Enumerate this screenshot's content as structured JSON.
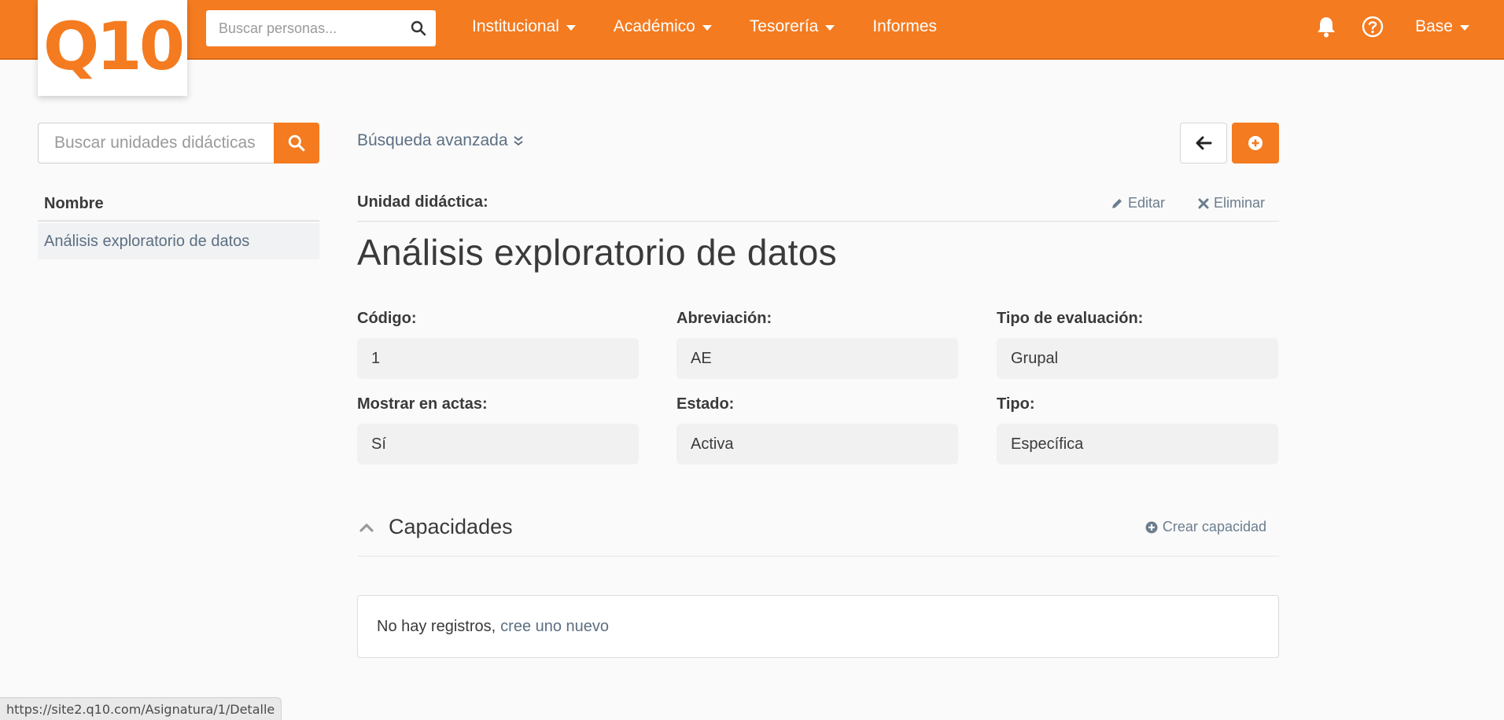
{
  "header": {
    "logo_text": "Q10",
    "search": {
      "placeholder": "Buscar personas..."
    },
    "nav": [
      {
        "label": "Institucional",
        "has_dropdown": true
      },
      {
        "label": "Académico",
        "has_dropdown": true
      },
      {
        "label": "Tesorería",
        "has_dropdown": true
      },
      {
        "label": "Informes",
        "has_dropdown": false
      }
    ],
    "icons": [
      "bell-icon",
      "help-circle-icon"
    ],
    "user_menu": "Base"
  },
  "sidebar": {
    "search": {
      "placeholder": "Buscar unidades didácticas"
    },
    "column_header": "Nombre",
    "items": [
      {
        "label": "Análisis exploratorio de datos"
      }
    ]
  },
  "main": {
    "advanced_search": "Búsqueda avanzada",
    "section_label": "Unidad didáctica:",
    "edit_label": "Editar",
    "delete_label": "Eliminar",
    "title": "Análisis exploratorio de datos",
    "fields": {
      "codigo": {
        "label": "Código:",
        "value": "1"
      },
      "abreviacion": {
        "label": "Abreviación:",
        "value": "AE"
      },
      "tipo_evaluacion": {
        "label": "Tipo de evaluación:",
        "value": "Grupal"
      },
      "mostrar_actas": {
        "label": "Mostrar en actas:",
        "value": "Sí"
      },
      "estado": {
        "label": "Estado:",
        "value": "Activa"
      },
      "tipo": {
        "label": "Tipo:",
        "value": "Específica"
      }
    },
    "capacidades": {
      "title": "Capacidades",
      "create_label": "Crear capacidad",
      "empty_text": "No hay registros,",
      "empty_link": "cree uno nuevo"
    }
  },
  "statusbar": {
    "url": "https://site2.q10.com/Asignatura/1/Detalle"
  },
  "colors": {
    "brand": "#f47b20",
    "link": "#5c6f82",
    "field_bg": "#f1f1f2"
  }
}
